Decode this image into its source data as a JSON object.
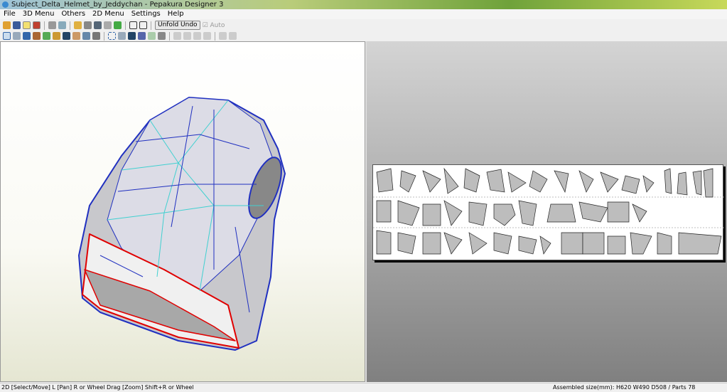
{
  "window": {
    "title": "Subject_Delta_Helmet_by_Jeddychan - Pepakura Designer 3"
  },
  "menu": [
    "File",
    "3D Menu",
    "Others",
    "2D Menu",
    "Settings",
    "Help"
  ],
  "toolbar": {
    "unfold_undo": "Unfold Undo",
    "auto": "Auto"
  },
  "colors": {
    "cut_edge": "#e00000",
    "mountain": "#2030c0",
    "valley": "#40d0d0",
    "face": "#c8c8c8"
  },
  "status": {
    "left": "2D [Select/Move] L [Pan] R or Wheel Drag [Zoom] Shift+R or Wheel",
    "right": "Assembled size(mm): H620 W490 D508 / Parts 78"
  }
}
